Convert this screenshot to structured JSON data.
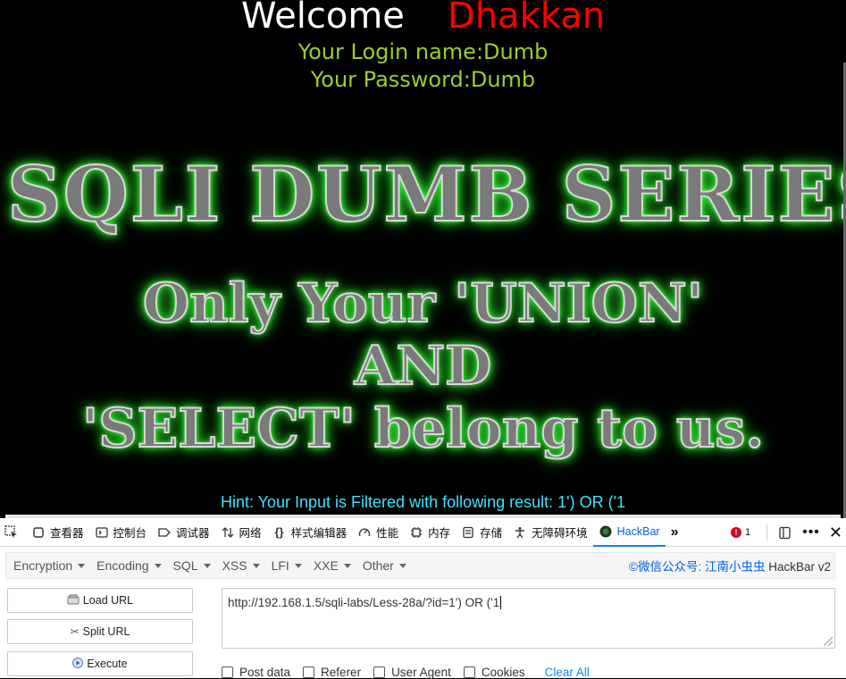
{
  "page": {
    "welcome": "Welcome",
    "user_highlight": "Dhakkan",
    "login_line": "Your Login name:Dumb",
    "password_line": "Your Password:Dumb",
    "banner_title": "SQLI DUMB SERIES",
    "banner_line1": "Only Your 'UNION'",
    "banner_line2": "AND",
    "banner_line3": "'SELECT' belong to us.",
    "hint": "Hint: Your Input is Filtered with following result: 1') OR ('1"
  },
  "devtools": {
    "tabs": [
      {
        "label": "查看器",
        "icon": "inspector-icon"
      },
      {
        "label": "控制台",
        "icon": "console-icon"
      },
      {
        "label": "调试器",
        "icon": "debugger-icon"
      },
      {
        "label": "网络",
        "icon": "network-icon"
      },
      {
        "label": "样式编辑器",
        "icon": "style-editor-icon"
      },
      {
        "label": "性能",
        "icon": "performance-icon"
      },
      {
        "label": "内存",
        "icon": "memory-icon"
      },
      {
        "label": "存储",
        "icon": "storage-icon"
      },
      {
        "label": "无障碍环境",
        "icon": "accessibility-icon"
      },
      {
        "label": "HackBar",
        "icon": "hackbar-icon"
      }
    ],
    "error_count": "1",
    "accent_color": "#0a84ff"
  },
  "hackbar": {
    "menus": [
      "Encryption",
      "Encoding",
      "SQL",
      "XSS",
      "LFI",
      "XXE",
      "Other"
    ],
    "brand_link": "©微信公众号: 江南小虫虫",
    "brand_text": "HackBar v2",
    "load_url": "Load URL",
    "split_url": "Split URL",
    "execute": "Execute",
    "url_value": "http://192.168.1.5/sqli-labs/Less-28a/?id=1') OR ('1",
    "options": [
      "Post data",
      "Referer",
      "User Agent",
      "Cookies"
    ],
    "clear_all": "Clear All"
  }
}
